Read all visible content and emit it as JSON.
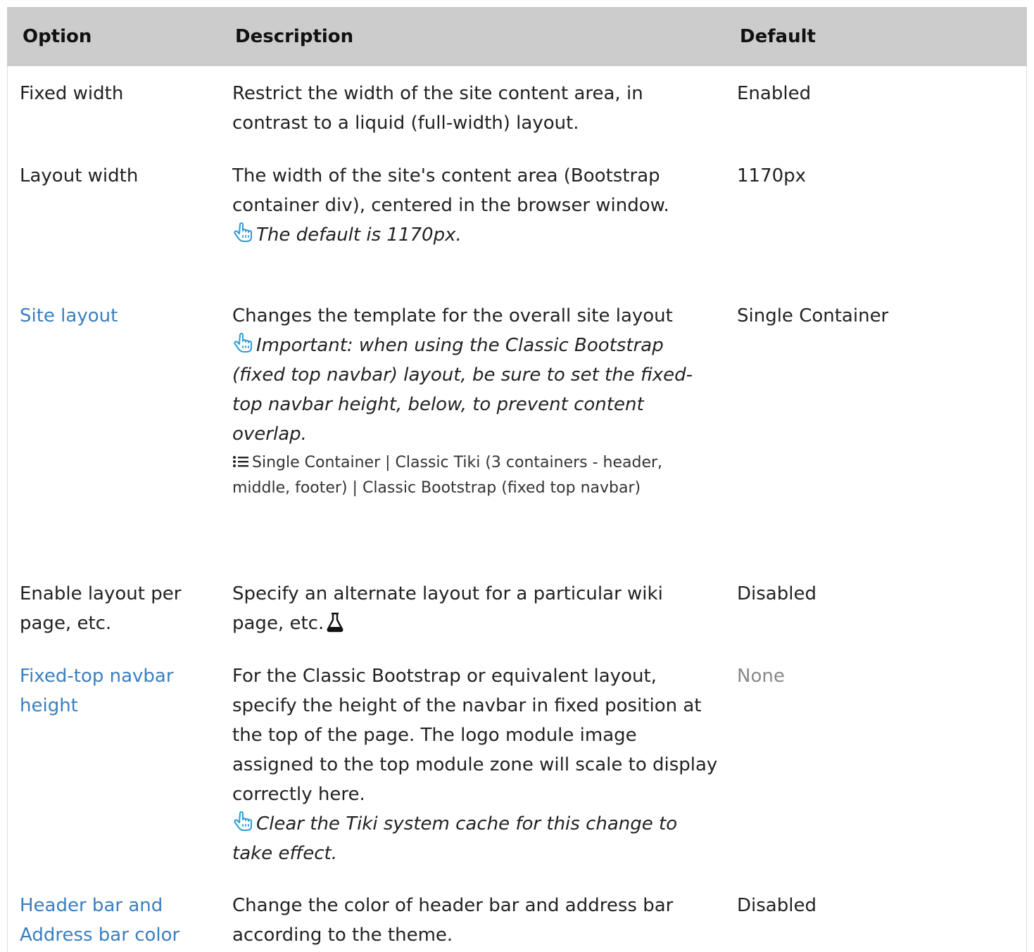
{
  "table": {
    "headers": {
      "option": "Option",
      "description": "Description",
      "default": "Default"
    },
    "rows": [
      {
        "option": "Fixed width",
        "option_is_link": false,
        "description": "Restrict the width of the site content area, in contrast to a liquid (full-width) layout.",
        "default": "Enabled"
      },
      {
        "option": "Layout width",
        "option_is_link": false,
        "description": "The width of the site's content area (Bootstrap container div), centered in the browser window.",
        "note": "The default is 1170px.",
        "default": "1170px"
      },
      {
        "option": "Site layout",
        "option_is_link": true,
        "description": "Changes the template for the overall site layout",
        "note": "Important: when using the Classic Bootstrap (fixed top navbar) layout, be sure to set the fixed-top navbar height, below, to prevent content overlap.",
        "options_list": "Single Container | Classic Tiki (3 containers - header, middle, footer) | Classic Bootstrap (fixed top navbar)",
        "default": "Single Container"
      },
      {
        "option": "Enable layout per page, etc.",
        "option_is_link": false,
        "description": "Specify an alternate layout for a particular wiki page, etc.",
        "experimental_icon": "flask-icon",
        "default": "Disabled"
      },
      {
        "option": "Fixed-top navbar height",
        "option_is_link": true,
        "description": "For the Classic Bootstrap or equivalent layout, specify the height of the navbar in fixed position at the top of the page. The logo module image assigned to the top module zone will scale to display correctly here.",
        "note": "Clear the Tiki system cache for this change to take effect.",
        "default": "None",
        "default_muted": true
      },
      {
        "option": "Header bar and Address bar color",
        "option_is_link": true,
        "description": "Change the color of header bar and address bar according to the theme.",
        "default": "Disabled"
      }
    ]
  },
  "icons": {
    "note_icon": "pointing-hand-icon",
    "list_icon": "list-icon",
    "experimental_icon": "flask-icon"
  },
  "colors": {
    "header_bg": "#cccccc",
    "link": "#3a7fc0",
    "icon_blue": "#2a9bd6",
    "muted": "#888888"
  }
}
